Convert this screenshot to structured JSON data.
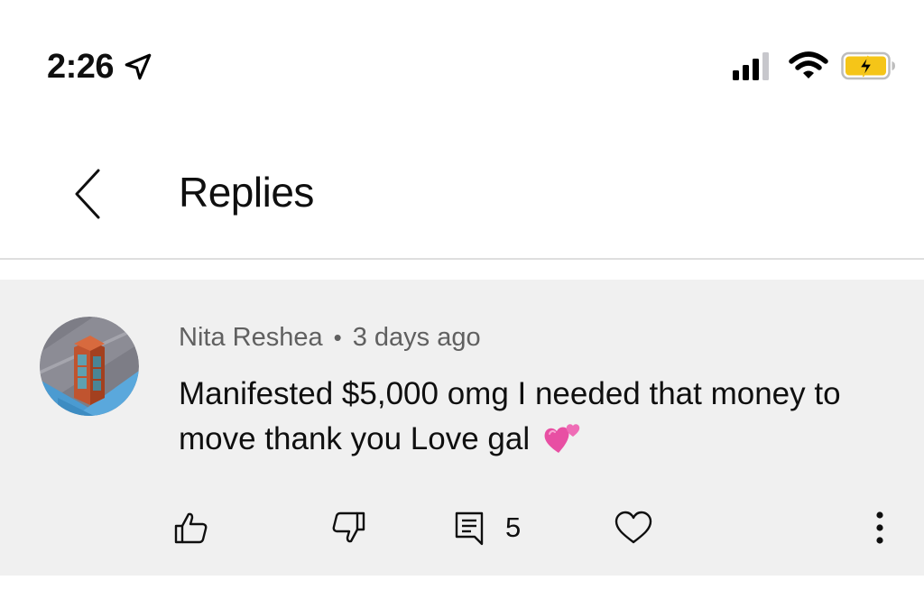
{
  "status_bar": {
    "time": "2:26",
    "icons": [
      "location-arrow-icon",
      "cellular-signal-icon",
      "wifi-icon",
      "battery-charging-icon"
    ],
    "battery_color": "#f5c518"
  },
  "header": {
    "back_icon": "chevron-left-icon",
    "title": "Replies"
  },
  "comment": {
    "author": "Nita Reshea",
    "separator": "•",
    "time_ago": "3 days ago",
    "text": "Manifested $5,000 omg I needed that money to move thank you Love gal",
    "emoji": "two-hearts-emoji",
    "avatar": "phone-booth-avatar",
    "actions": {
      "like_icon": "thumbs-up-icon",
      "dislike_icon": "thumbs-down-icon",
      "reply_icon": "reply-comment-icon",
      "reply_count": "5",
      "heart_icon": "heart-icon",
      "more_icon": "more-vertical-icon"
    },
    "background": "#f0f0f0"
  }
}
